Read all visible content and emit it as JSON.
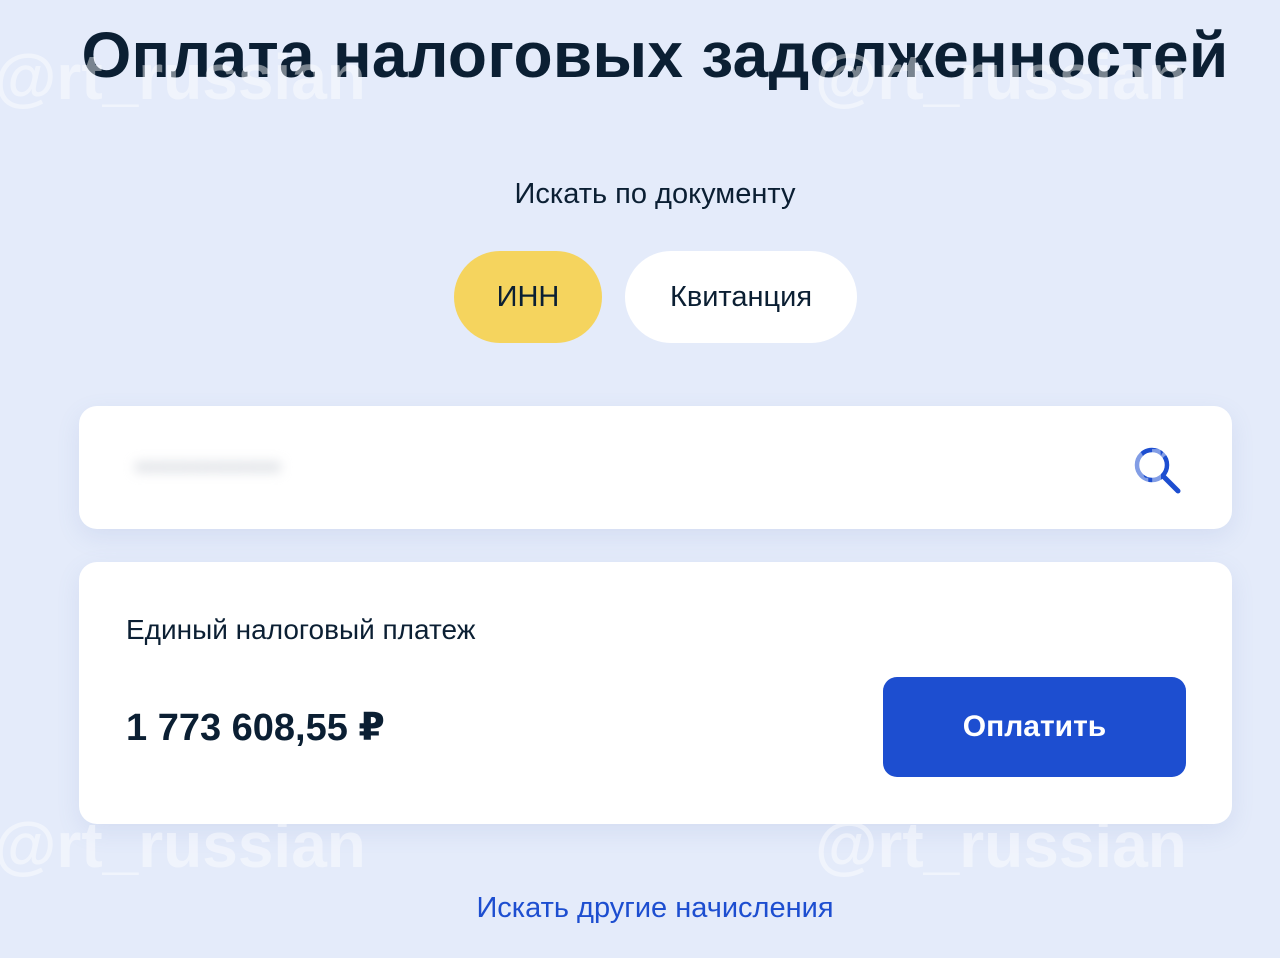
{
  "header": {
    "title": "Оплата налоговых задолженностей"
  },
  "search_by": {
    "label": "Искать по документу",
    "options": [
      {
        "label": "ИНН",
        "selected": true
      },
      {
        "label": "Квитанция",
        "selected": false
      }
    ]
  },
  "search": {
    "value": "•••••••••••••",
    "icon": "search-icon"
  },
  "payment": {
    "name": "Единый налоговый платеж",
    "amount": "1 773 608,55 ₽",
    "pay_label": "Оплатить"
  },
  "footer": {
    "link_label": "Искать другие начисления"
  },
  "watermarks": {
    "handle": "@rt_russian"
  },
  "colors": {
    "background": "#e4ebfa",
    "selected_option": "#f5d45e",
    "primary": "#1d4ed0",
    "text": "#0b1f33"
  }
}
